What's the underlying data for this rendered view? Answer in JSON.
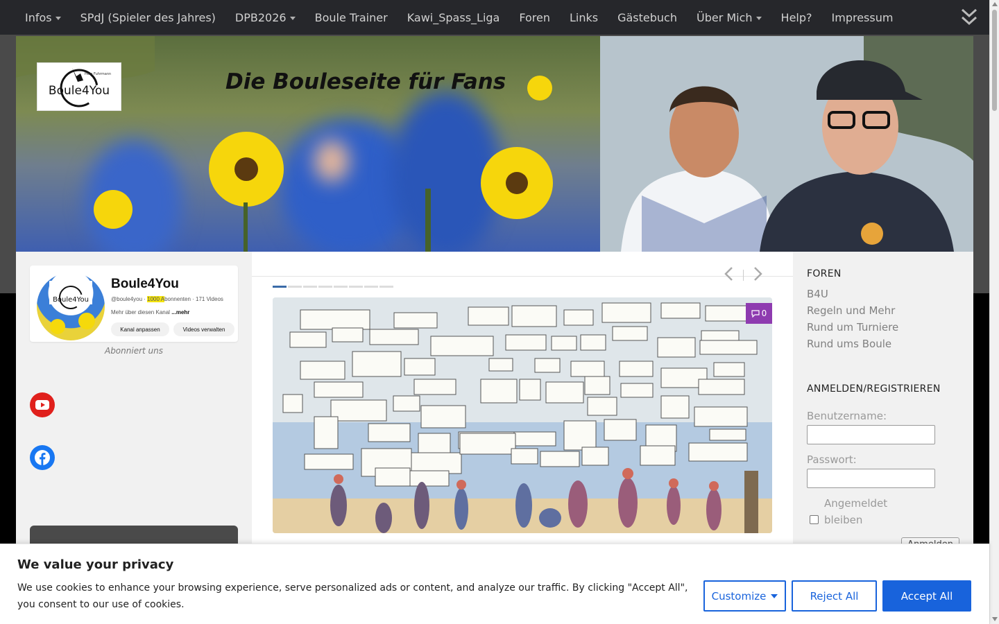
{
  "nav": {
    "items": [
      {
        "label": "Infos",
        "dropdown": true
      },
      {
        "label": "SPdJ (Spieler des Jahres)",
        "dropdown": false
      },
      {
        "label": "DPB2026",
        "dropdown": true
      },
      {
        "label": "Boule Trainer",
        "dropdown": false
      },
      {
        "label": "Kawi_Spass_Liga",
        "dropdown": false
      },
      {
        "label": "Foren",
        "dropdown": false
      },
      {
        "label": "Links",
        "dropdown": false
      },
      {
        "label": "Gästebuch",
        "dropdown": false
      },
      {
        "label": "Über Mich",
        "dropdown": true
      },
      {
        "label": "Help?",
        "dropdown": false
      },
      {
        "label": "Impressum",
        "dropdown": false
      }
    ]
  },
  "header": {
    "logo_text": "Boule4You",
    "logo_small": "Hein Fuhrmann",
    "title": "Die Bouleseite für Fans"
  },
  "youtube_card": {
    "channel_name": "Boule4You",
    "handle": "@boule4you",
    "subscribers_highlight": "1000 A",
    "subscribers_rest": "bonnenten",
    "videos": "171 Videos",
    "description": "Mehr über diesen Kanal",
    "more": "...mehr",
    "btn_customize": "Kanal anpassen",
    "btn_manage": "Videos verwalten",
    "caption": "Abonniert uns"
  },
  "slider": {
    "comment_count": "0",
    "dots": 8
  },
  "right_sidebar": {
    "foren_heading": "FOREN",
    "foren_links": [
      "B4U",
      "Regeln und Mehr",
      "Rund um Turniere",
      "Rund ums Boule"
    ],
    "login_heading": "ANMELDEN/REGISTRIEREN",
    "username_label": "Benutzername:",
    "password_label": "Passwort:",
    "remember_label_1": "Angemeldet",
    "remember_label_2": "bleiben",
    "login_button": "Anmelden"
  },
  "cookie": {
    "title": "We value your privacy",
    "text": "We use cookies to enhance your browsing experience, serve personalized ads or content, and analyze our traffic. By clicking \"Accept All\", you consent to our use of cookies.",
    "customize": "Customize",
    "reject": "Reject All",
    "accept": "Accept All"
  },
  "colors": {
    "nav_bg": "#26272b",
    "accent_blue": "#1863dc",
    "comment_badge": "#8e3bb0",
    "youtube_red": "#e0201c",
    "facebook_blue": "#1877f2"
  }
}
